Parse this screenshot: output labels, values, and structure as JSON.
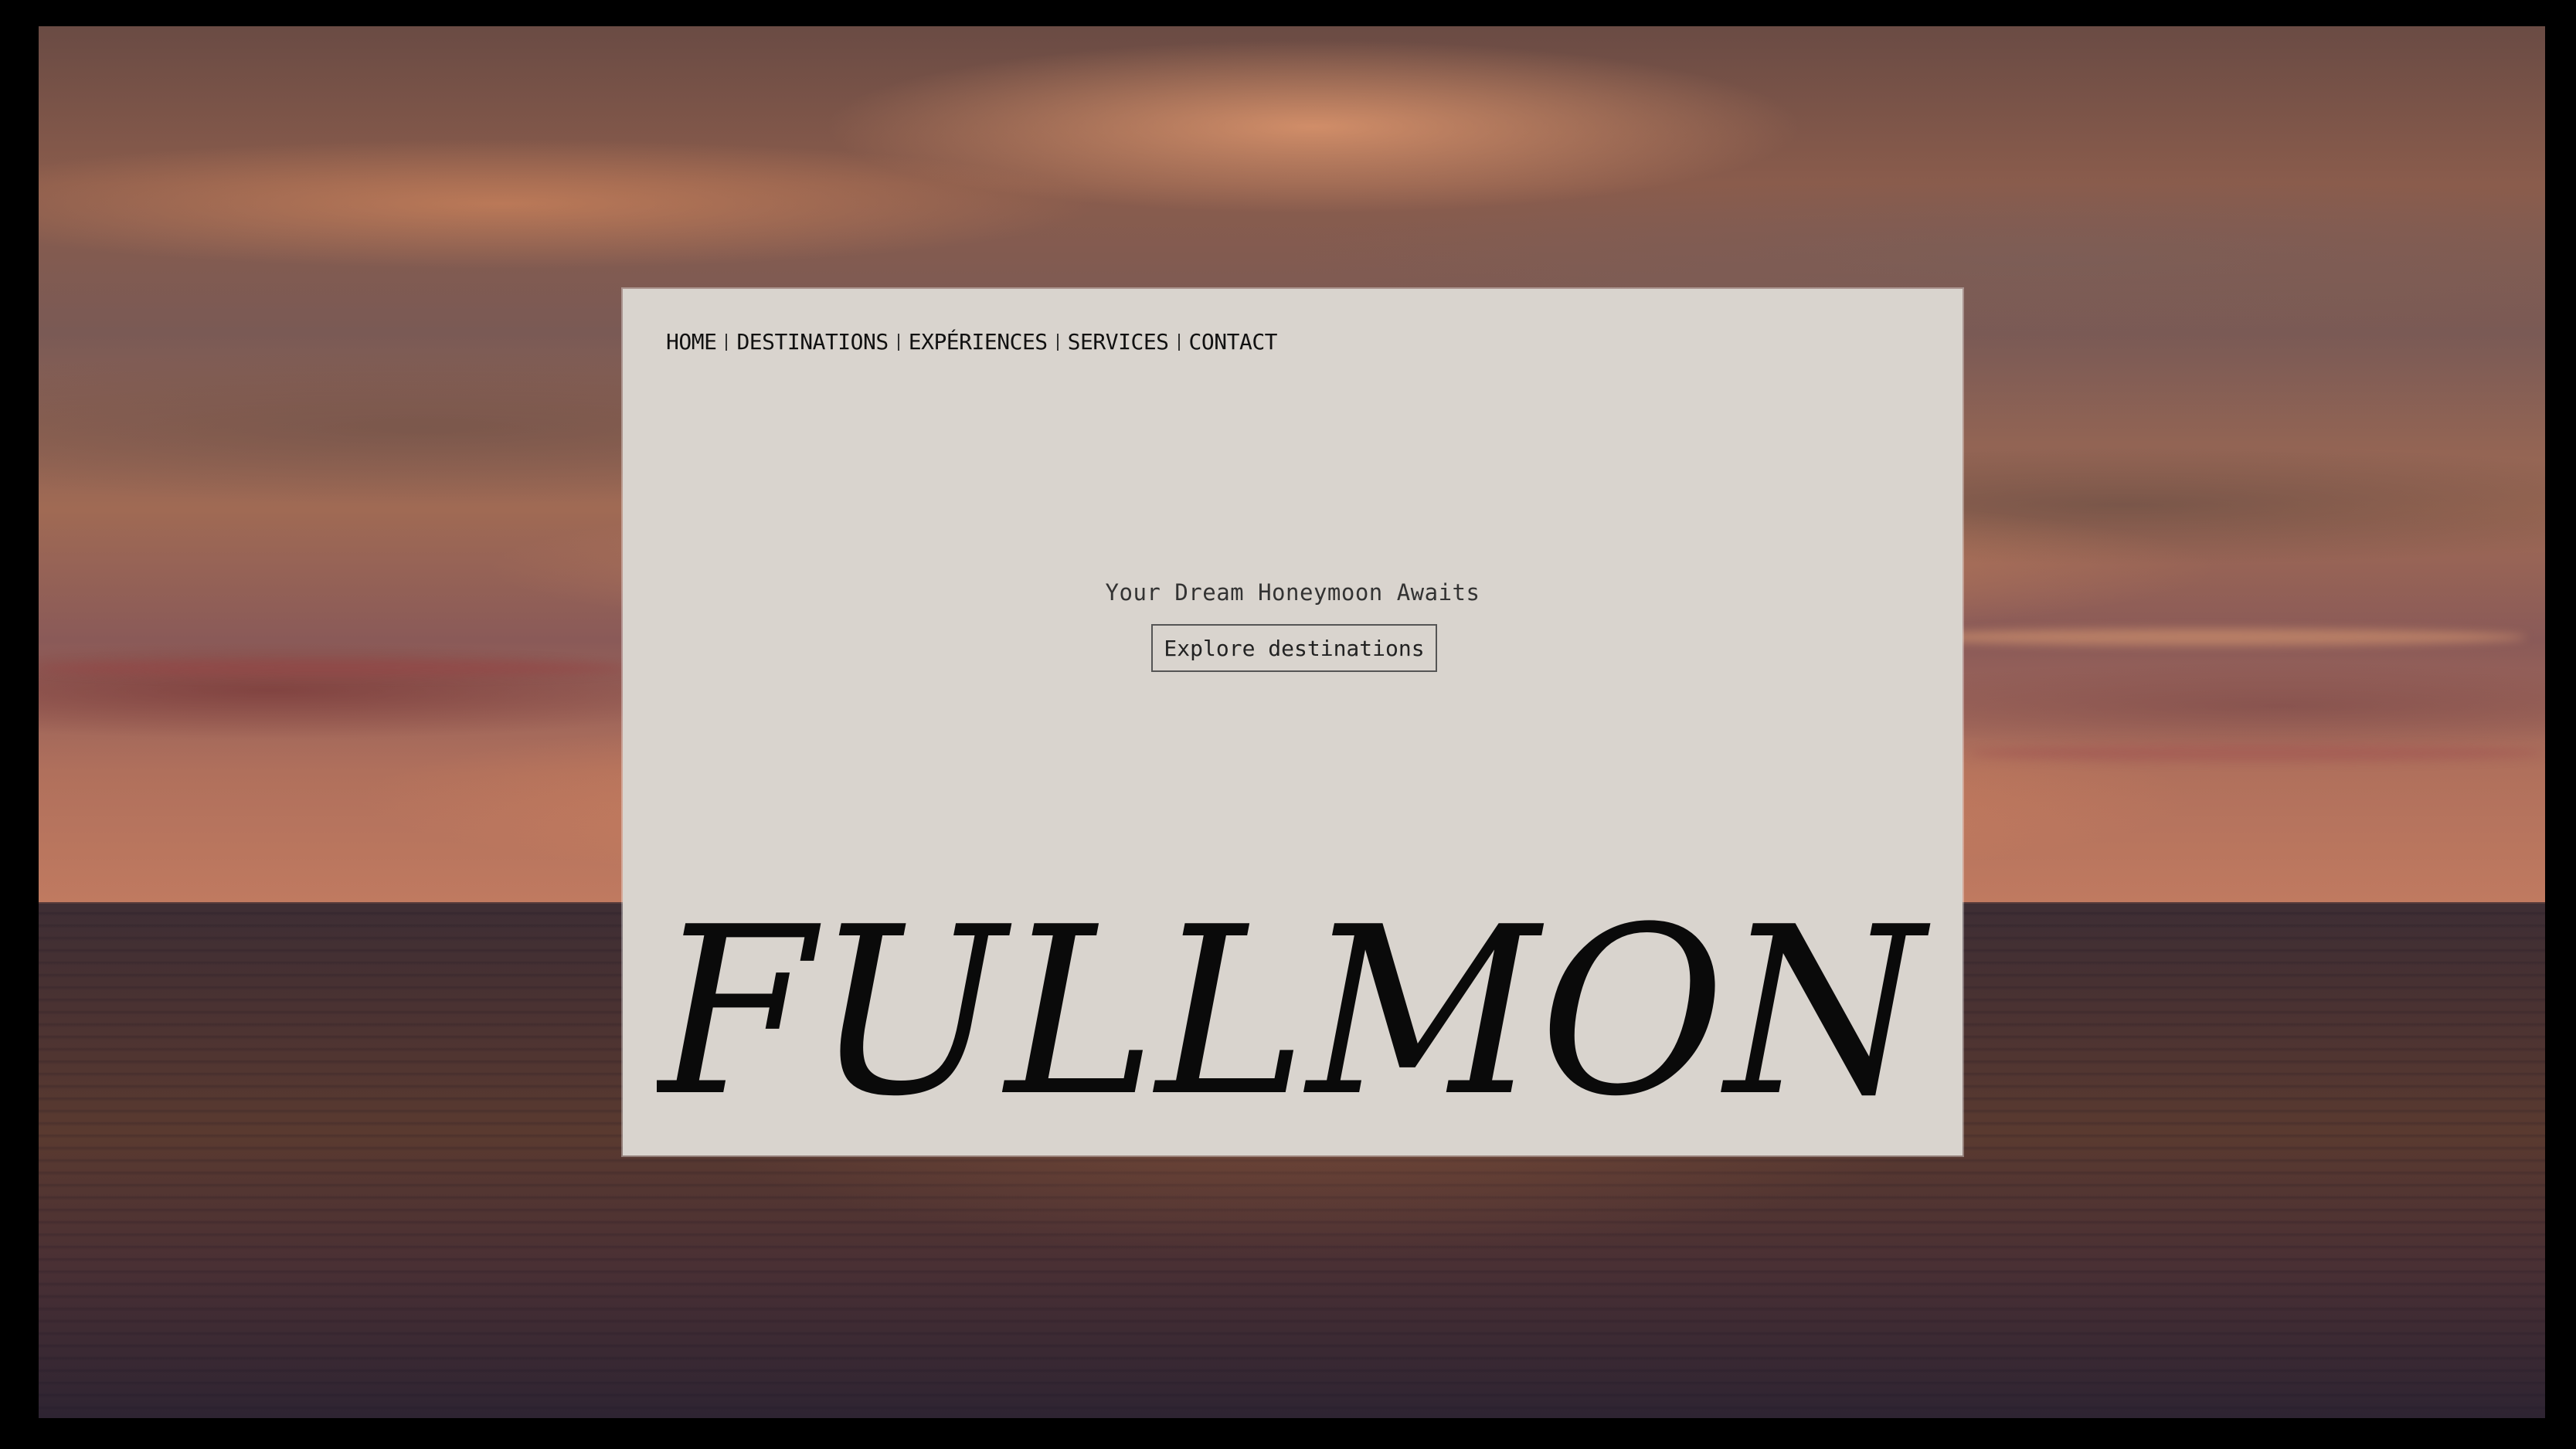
{
  "nav": {
    "items": [
      {
        "label": "HOME"
      },
      {
        "label": "DESTINATIONS"
      },
      {
        "label": "EXPÉRIENCES"
      },
      {
        "label": "SERVICES"
      },
      {
        "label": "CONTACT"
      }
    ]
  },
  "hero": {
    "tagline": "Your Dream Honeymoon Awaits",
    "cta_label": "Explore destinations"
  },
  "brand": {
    "logo_text": "FULLMON"
  },
  "colors": {
    "card_bg": "#d9d4ce",
    "text": "#111111",
    "frame": "#000000"
  }
}
